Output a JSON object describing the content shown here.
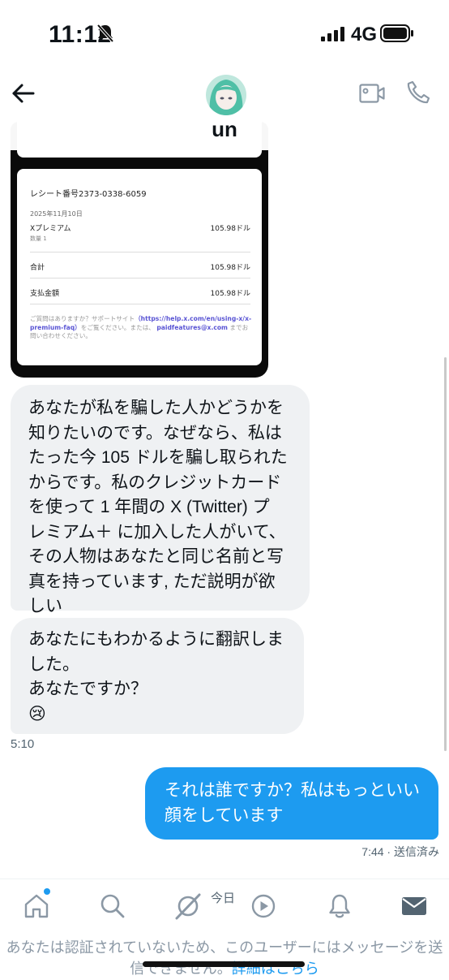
{
  "status_bar": {
    "time": "11:12",
    "network": "4G"
  },
  "header": {
    "contact_name": "un",
    "icons": [
      "back-arrow-icon",
      "video-call-icon",
      "phone-icon"
    ]
  },
  "receipt_image": {
    "receipt_number": "レシート番号2373-0338-6059",
    "date": "2025年11月10日",
    "item_name": "Xプレミアム",
    "item_price": "105.98ドル",
    "quantity": "数量 1",
    "total_label": "合計",
    "total_price": "105.98ドル",
    "paid_label": "支払金額",
    "paid_price": "105.98ドル",
    "help_text_1": "ご質問はありますか？サポートサイト",
    "help_link": "（https://help.x.com/en/using-x/x-premium-faq）",
    "help_text_2": "をご覧ください。または、",
    "help_email": "paidfeatures@x.com",
    "help_text_3": "までお問い合わせください。"
  },
  "messages": {
    "incoming_1": [
      "あなたが私を騙した人かどうかを",
      "知りたいのです。なぜなら、私は",
      "たった今 105 ドルを騙し取られた",
      "からです。私のクレジットカード",
      "を使って 1 年間の X (Twitter) プ",
      "レミアム＋ に加入した人がいて、",
      "その人物はあなたと同じ名前と写",
      "真を持っています, ただ説明が欲",
      "しい"
    ],
    "incoming_2": [
      "あなたにもわかるように翻訳しま",
      "した。",
      "あなたですか？",
      "😢"
    ],
    "incoming_time": "5:10",
    "outgoing_1": [
      "それは誰ですか？私はもっといい",
      "顔をしています"
    ],
    "outgoing_time": "7:44 · 送信済み"
  },
  "bottom_nav": {
    "items": [
      "home-icon",
      "search-icon",
      "grok-icon",
      "video-icon",
      "notifications-icon",
      "messages-icon"
    ],
    "today_label": "今日",
    "restriction_text": "あなたは認証されていないため、このユーザーにはメッセージを送信できません。",
    "details_link": "詳細はこちら"
  },
  "colors": {
    "accent": "#1d9bf0",
    "incoming_bubble": "#eff1f3",
    "muted_text": "#536471"
  }
}
